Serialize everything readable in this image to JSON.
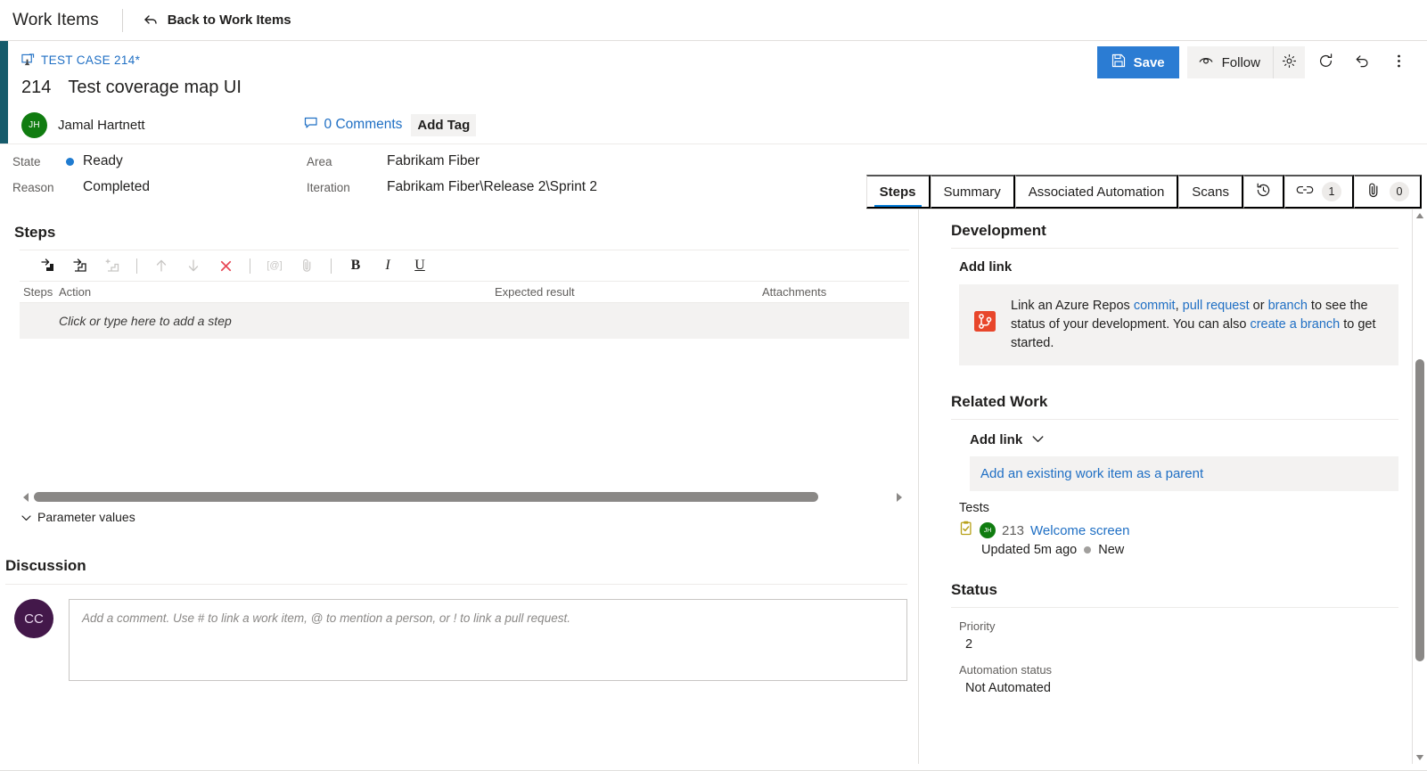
{
  "topbar": {
    "title": "Work Items",
    "back_label": "Back to Work Items",
    "back_icon": "back-arrow-icon"
  },
  "workitem": {
    "type_label": "TEST CASE 214*",
    "type_icon": "test-case-icon",
    "id": "214",
    "title": "Test coverage map UI",
    "assignee": "Jamal Hartnett",
    "assignee_initials": "JH",
    "comments_label": "0 Comments",
    "comments_icon": "comment-icon",
    "add_tag_label": "Add Tag",
    "accent_color": "#165b6b"
  },
  "actions": {
    "save_label": "Save",
    "save_icon": "save-disk-icon",
    "follow_label": "Follow",
    "follow_icon": "eye-icon",
    "gear_icon": "gear-icon",
    "refresh_icon": "refresh-icon",
    "revert_icon": "undo-icon",
    "more_icon": "kebab-menu-icon",
    "accent_color": "#2b7cd3"
  },
  "fields": {
    "state_label": "State",
    "state_value": "Ready",
    "state_dot_color": "#1f7bd0",
    "reason_label": "Reason",
    "reason_value": "Completed",
    "area_label": "Area",
    "area_value": "Fabrikam Fiber",
    "iteration_label": "Iteration",
    "iteration_value": "Fabrikam Fiber\\Release 2\\Sprint 2"
  },
  "tabs": {
    "items": [
      {
        "label": "Steps",
        "active": true
      },
      {
        "label": "Summary",
        "active": false
      },
      {
        "label": "Associated Automation",
        "active": false
      },
      {
        "label": "Scans",
        "active": false
      }
    ],
    "history_icon": "history-clock-icon",
    "links_icon": "link-chain-icon",
    "links_count": "1",
    "attachments_icon": "paperclip-icon",
    "attachments_count": "0",
    "active_underline_color": "#0078d4"
  },
  "steps": {
    "section_title": "Steps",
    "toolbar": [
      {
        "name": "insert-step-icon",
        "disabled": false
      },
      {
        "name": "insert-shared-step-icon",
        "disabled": false
      },
      {
        "name": "add-shared-step-icon",
        "disabled": true
      },
      {
        "name": "separator",
        "disabled": true
      },
      {
        "name": "move-up-icon",
        "disabled": true
      },
      {
        "name": "move-down-icon",
        "disabled": true
      },
      {
        "name": "delete-step-icon",
        "disabled": false
      },
      {
        "name": "separator",
        "disabled": true
      },
      {
        "name": "mention-icon",
        "disabled": true
      },
      {
        "name": "attach-icon",
        "disabled": true
      },
      {
        "name": "separator",
        "disabled": true
      },
      {
        "name": "bold-icon",
        "label": "B",
        "disabled": false
      },
      {
        "name": "italic-icon",
        "label": "I",
        "disabled": false
      },
      {
        "name": "underline-icon",
        "label": "U",
        "disabled": false
      }
    ],
    "columns": [
      "Steps",
      "Action",
      "Expected result",
      "Attachments"
    ],
    "empty_row_text": "Click or type here to add a step",
    "parameter_values_label": "Parameter values"
  },
  "discussion": {
    "title": "Discussion",
    "avatar_initials": "CC",
    "placeholder": "Add a comment. Use # to link a work item, @ to mention a person, or ! to link a pull request."
  },
  "development": {
    "title": "Development",
    "add_link_label": "Add link",
    "icon": "repos-branch-icon",
    "text_1": "Link an Azure Repos ",
    "link_commit": "commit",
    "text_2": ", ",
    "link_pull_request": "pull request",
    "text_3": " or ",
    "link_branch": "branch",
    "text_4": " to see the status of your development. You can also ",
    "link_create_branch": "create a branch",
    "text_5": " to get started."
  },
  "related_work": {
    "title": "Related Work",
    "add_link_label": "Add link",
    "chevron_icon": "chevron-down-icon",
    "parent_prompt": "Add an existing work item as a parent",
    "group_label": "Tests",
    "item": {
      "icon": "test-case-clipboard-icon",
      "avatar_initials": "JH",
      "id": "213",
      "name": "Welcome screen",
      "updated": "Updated 5m ago",
      "state": "New",
      "state_dot_color": "#a19f9d"
    }
  },
  "status": {
    "title": "Status",
    "fields": [
      {
        "label": "Priority",
        "value": "2"
      },
      {
        "label": "Automation status",
        "value": "Not Automated"
      }
    ]
  },
  "scrollbars": {
    "horizontal_name": "steps-horizontal-scrollbar",
    "vertical_name": "page-vertical-scrollbar"
  }
}
